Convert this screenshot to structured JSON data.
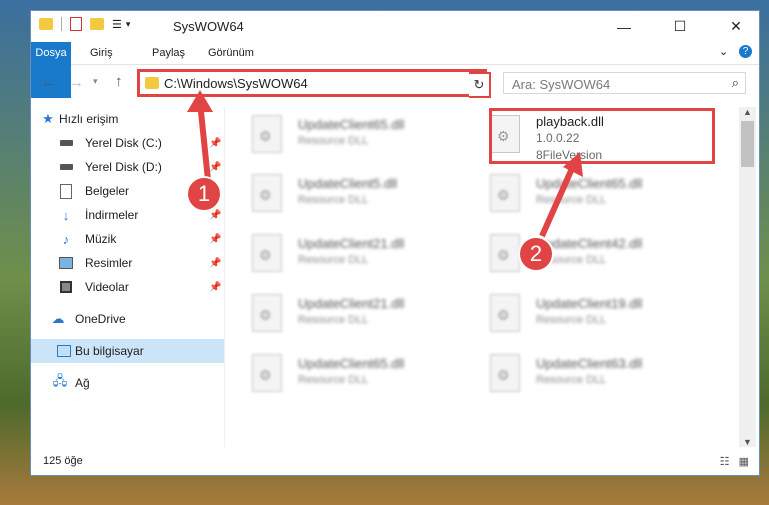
{
  "window": {
    "title": "SysWOW64"
  },
  "ribbon": {
    "tabs": [
      "Dosya",
      "Giriş",
      "Paylaş",
      "Görünüm"
    ]
  },
  "address": {
    "path": "C:\\Windows\\SysWOW64"
  },
  "search": {
    "placeholder": "Ara: SysWOW64"
  },
  "sidebar": {
    "items": [
      {
        "label": "Hızlı erişim",
        "icon": "star-icon",
        "pinned": false
      },
      {
        "label": "Yerel Disk (C:)",
        "icon": "drive-icon",
        "pinned": true
      },
      {
        "label": "Yerel Disk (D:)",
        "icon": "drive-icon",
        "pinned": true
      },
      {
        "label": "Belgeler",
        "icon": "documents-icon",
        "pinned": true
      },
      {
        "label": "İndirmeler",
        "icon": "download-icon",
        "pinned": true
      },
      {
        "label": "Müzik",
        "icon": "music-icon",
        "pinned": true
      },
      {
        "label": "Resimler",
        "icon": "pictures-icon",
        "pinned": true
      },
      {
        "label": "Videolar",
        "icon": "videos-icon",
        "pinned": true
      },
      {
        "label": "OneDrive",
        "icon": "cloud-icon",
        "pinned": false
      },
      {
        "label": "Bu bilgisayar",
        "icon": "computer-icon",
        "pinned": false
      },
      {
        "label": "Ağ",
        "icon": "network-icon",
        "pinned": false
      }
    ]
  },
  "files": {
    "highlighted": {
      "name": "playback.dll",
      "version": "1.0.0.22",
      "type": "8FileVersion"
    },
    "left_column": [
      {
        "name": "UpdateClient65.dll",
        "type": "Resource DLL"
      },
      {
        "name": "UpdateClient5.dll",
        "type": "Resource DLL"
      },
      {
        "name": "UpdateClient21.dll",
        "type": "Resource DLL"
      },
      {
        "name": "UpdateClient21.dll",
        "type": "Resource DLL"
      },
      {
        "name": "UpdateClient65.dll",
        "type": "Resource DLL"
      }
    ],
    "right_column": [
      {
        "name": "UpdateClient65.dll",
        "type": "Resource DLL"
      },
      {
        "name": "UpdateClient42.dll",
        "type": "Resource DLL"
      },
      {
        "name": "UpdateClient19.dll",
        "type": "Resource DLL"
      },
      {
        "name": "UpdateClient63.dll",
        "type": "Resource DLL"
      }
    ]
  },
  "status": {
    "item_count": "125 öğe"
  },
  "annotations": {
    "marker1": "1",
    "marker2": "2"
  },
  "colors": {
    "highlight": "#e04444",
    "file_tab": "#1979ca",
    "selected_nav": "#cce4f7"
  }
}
